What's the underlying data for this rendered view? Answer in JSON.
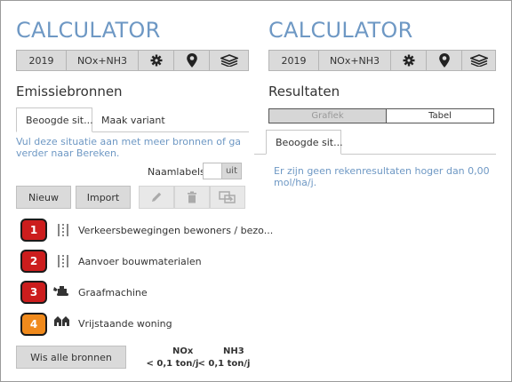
{
  "left": {
    "app_title": "CALCULATOR",
    "toolbar": {
      "year": "2019",
      "substance": "NOx+NH3"
    },
    "section_title": "Emissiebronnen",
    "tabs": [
      "Beoogde sit...",
      "Maak variant"
    ],
    "info": "Vul deze situatie aan met meer bronnen of ga verder naar Bereken.",
    "naamlabels_label": "Naamlabels",
    "naamlabels_toggle": "uit",
    "new_label": "Nieuw",
    "import_label": "Import",
    "sources": [
      {
        "number": "1",
        "label": "Verkeersbewegingen bewoners / bezo...",
        "color": "#cc1d1d",
        "icon": "road-icon"
      },
      {
        "number": "2",
        "label": "Aanvoer bouwmaterialen",
        "color": "#cc1d1d",
        "icon": "road-icon"
      },
      {
        "number": "3",
        "label": "Graafmachine",
        "color": "#cc1d1d",
        "icon": "excavator-icon"
      },
      {
        "number": "4",
        "label": "Vrijstaande woning",
        "color": "#f08a1c",
        "icon": "house-icon"
      }
    ],
    "clear_all_label": "Wis alle bronnen",
    "totals": [
      {
        "name": "NOx",
        "value": "< 0,1 ton/j"
      },
      {
        "name": "NH3",
        "value": "< 0,1 ton/j"
      }
    ]
  },
  "right": {
    "app_title": "CALCULATOR",
    "toolbar": {
      "year": "2019",
      "substance": "NOx+NH3"
    },
    "section_title": "Resultaten",
    "toggle": [
      "Grafiek",
      "Tabel"
    ],
    "tab": "Beoogde sit...",
    "info": "Er zijn geen rekenresultaten hoger dan 0,00 mol/ha/j."
  }
}
